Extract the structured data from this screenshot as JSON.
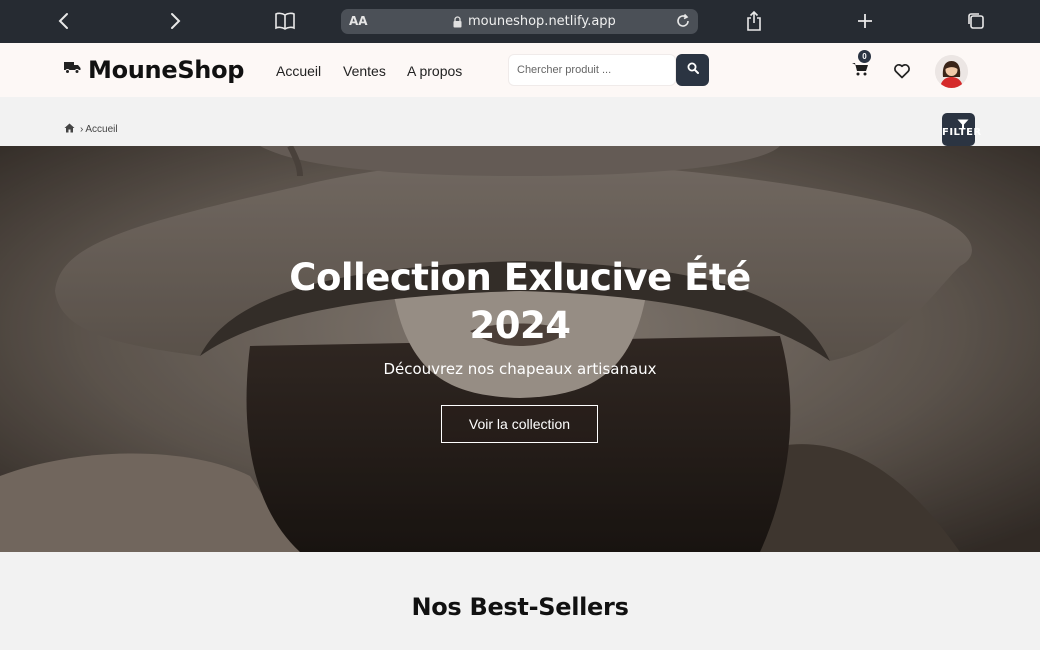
{
  "browser": {
    "url": "mouneshop.netlify.app",
    "text_size_label": "AA",
    "icons": [
      "back-icon",
      "forward-icon",
      "bookmarks-icon",
      "reload-icon",
      "share-icon",
      "new-tab-icon",
      "tabs-icon"
    ]
  },
  "header": {
    "logo_text": "MouneShop",
    "nav": [
      "Accueil",
      "Ventes",
      "A propos"
    ],
    "search_placeholder": "Chercher produit ...",
    "cart_count": "0"
  },
  "breadcrumb": {
    "label": "Accueil"
  },
  "filter": {
    "label": "FILTER"
  },
  "hero": {
    "title_line1": "Collection Exlucive Été",
    "title_line2": "2024",
    "subtitle": "Découvrez nos chapeaux artisanaux",
    "button_label": "Voir la collection"
  },
  "section": {
    "title": "Nos Best-Sellers"
  },
  "colors": {
    "browser_bar": "#262b32",
    "accent_dark": "#2b3442",
    "header_bg": "#fdf8f6"
  }
}
